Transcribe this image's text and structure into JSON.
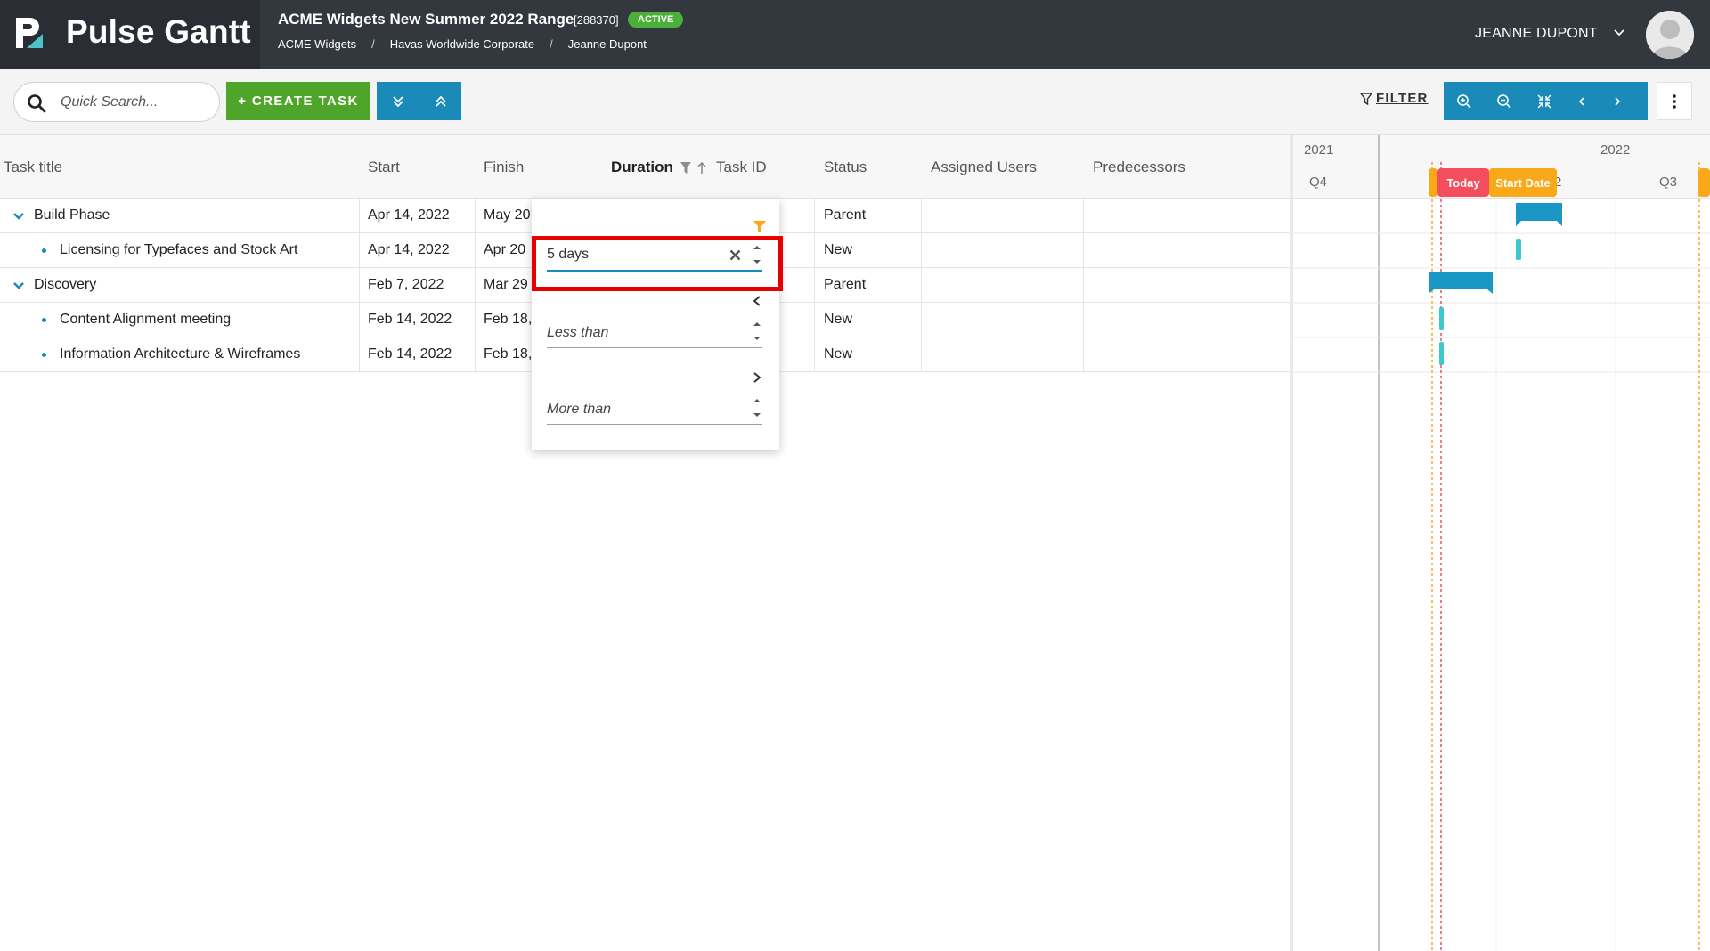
{
  "app": {
    "name": "Pulse Gantt"
  },
  "project": {
    "title": "ACME Widgets New Summer 2022 Range",
    "id": "[288370]",
    "status": "ACTIVE",
    "breadcrumbs": [
      "ACME Widgets",
      "Havas Worldwide Corporate",
      "Jeanne Dupont"
    ]
  },
  "user": {
    "name": "JEANNE DUPONT"
  },
  "toolbar": {
    "search_placeholder": "Quick Search...",
    "create_label": "+ CREATE TASK",
    "filter_label": "FILTER"
  },
  "columns": {
    "task_title": "Task title",
    "start": "Start",
    "finish": "Finish",
    "duration": "Duration",
    "task_id": "Task ID",
    "status": "Status",
    "assigned_users": "Assigned Users",
    "predecessors": "Predecessors"
  },
  "rows": [
    {
      "title": "Build Phase",
      "start": "Apr 14, 2022",
      "finish": "May 20",
      "status": "Parent",
      "level": 0
    },
    {
      "title": "Licensing for Typefaces and Stock Art",
      "start": "Apr 14, 2022",
      "finish": "Apr 20",
      "status": "New",
      "level": 1
    },
    {
      "title": "Discovery",
      "start": "Feb 7, 2022",
      "finish": "Mar 29",
      "status": "Parent",
      "level": 0
    },
    {
      "title": "Content Alignment meeting",
      "start": "Feb 14, 2022",
      "finish": "Feb 18,",
      "status": "New",
      "level": 1
    },
    {
      "title": "Information Architecture & Wireframes",
      "start": "Feb 14, 2022",
      "finish": "Feb 18,",
      "status": "New",
      "level": 1
    }
  ],
  "timeline": {
    "years": [
      "2021",
      "2022"
    ],
    "quarters": [
      "Q4",
      "2",
      "Q3"
    ],
    "today_label": "Today",
    "start_date_label": "Start Date"
  },
  "duration_filter": {
    "equals_value": "5 days",
    "less_than_placeholder": "Less than",
    "more_than_placeholder": "More than"
  },
  "colors": {
    "header_bg": "#33383f",
    "create_green": "#4fa52a",
    "toolbar_blue": "#1a8ab8",
    "badge_green": "#4caf3a",
    "today_red": "#f44d5e",
    "start_orange": "#f9a918",
    "bar_parent": "#1a97c4",
    "bar_task": "#3ec7cf",
    "highlight_red": "#e60000"
  }
}
